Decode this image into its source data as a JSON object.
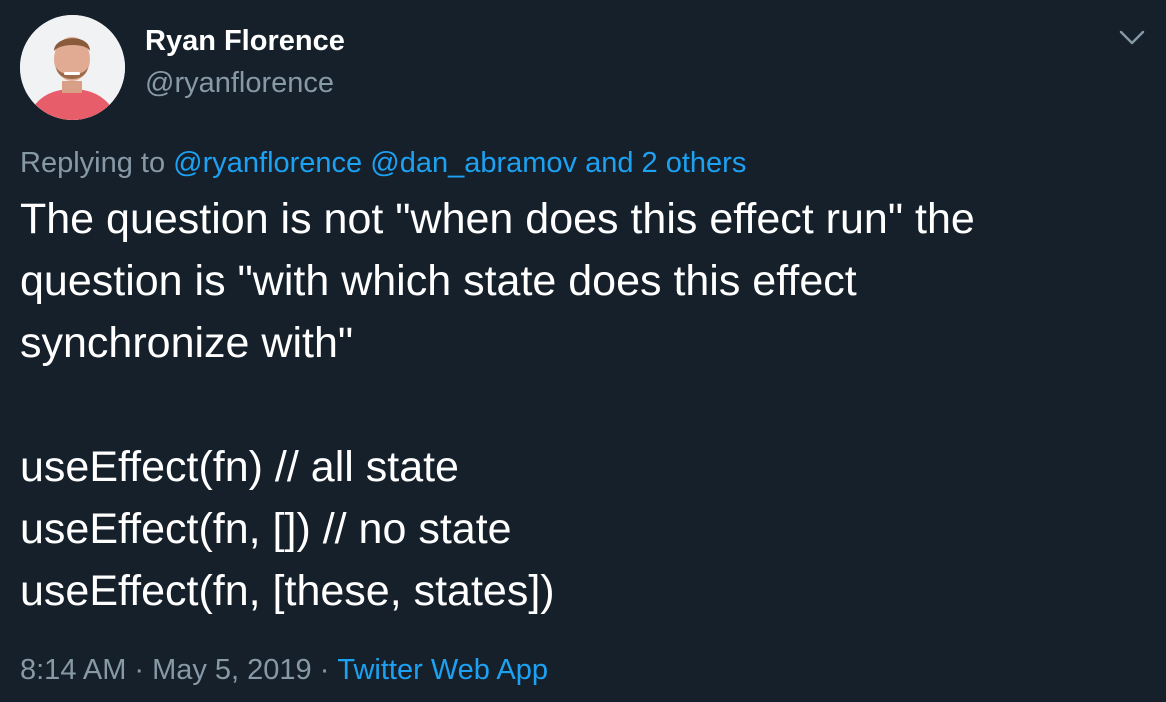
{
  "author": {
    "display_name": "Ryan Florence",
    "handle": "@ryanflorence"
  },
  "reply": {
    "prefix": "Replying to",
    "mentions": [
      "@ryanflorence",
      "@dan_abramov",
      "and 2 others"
    ]
  },
  "body": {
    "lines": [
      "The question is not \"when does this effect run\" the",
      "question is \"with which state does this effect",
      "synchronize with\"",
      "",
      "useEffect(fn) // all state",
      "useEffect(fn, []) // no state",
      "useEffect(fn, [these, states])"
    ]
  },
  "meta": {
    "time": "8:14 AM",
    "separator": "·",
    "date": "May 5, 2019",
    "source": "Twitter Web App"
  },
  "icons": {
    "menu": "chevron-down-icon",
    "avatar": "avatar"
  },
  "colors": {
    "background": "#15202b",
    "primary_text": "#ffffff",
    "secondary_text": "#8899a6",
    "accent": "#1da1f2"
  }
}
